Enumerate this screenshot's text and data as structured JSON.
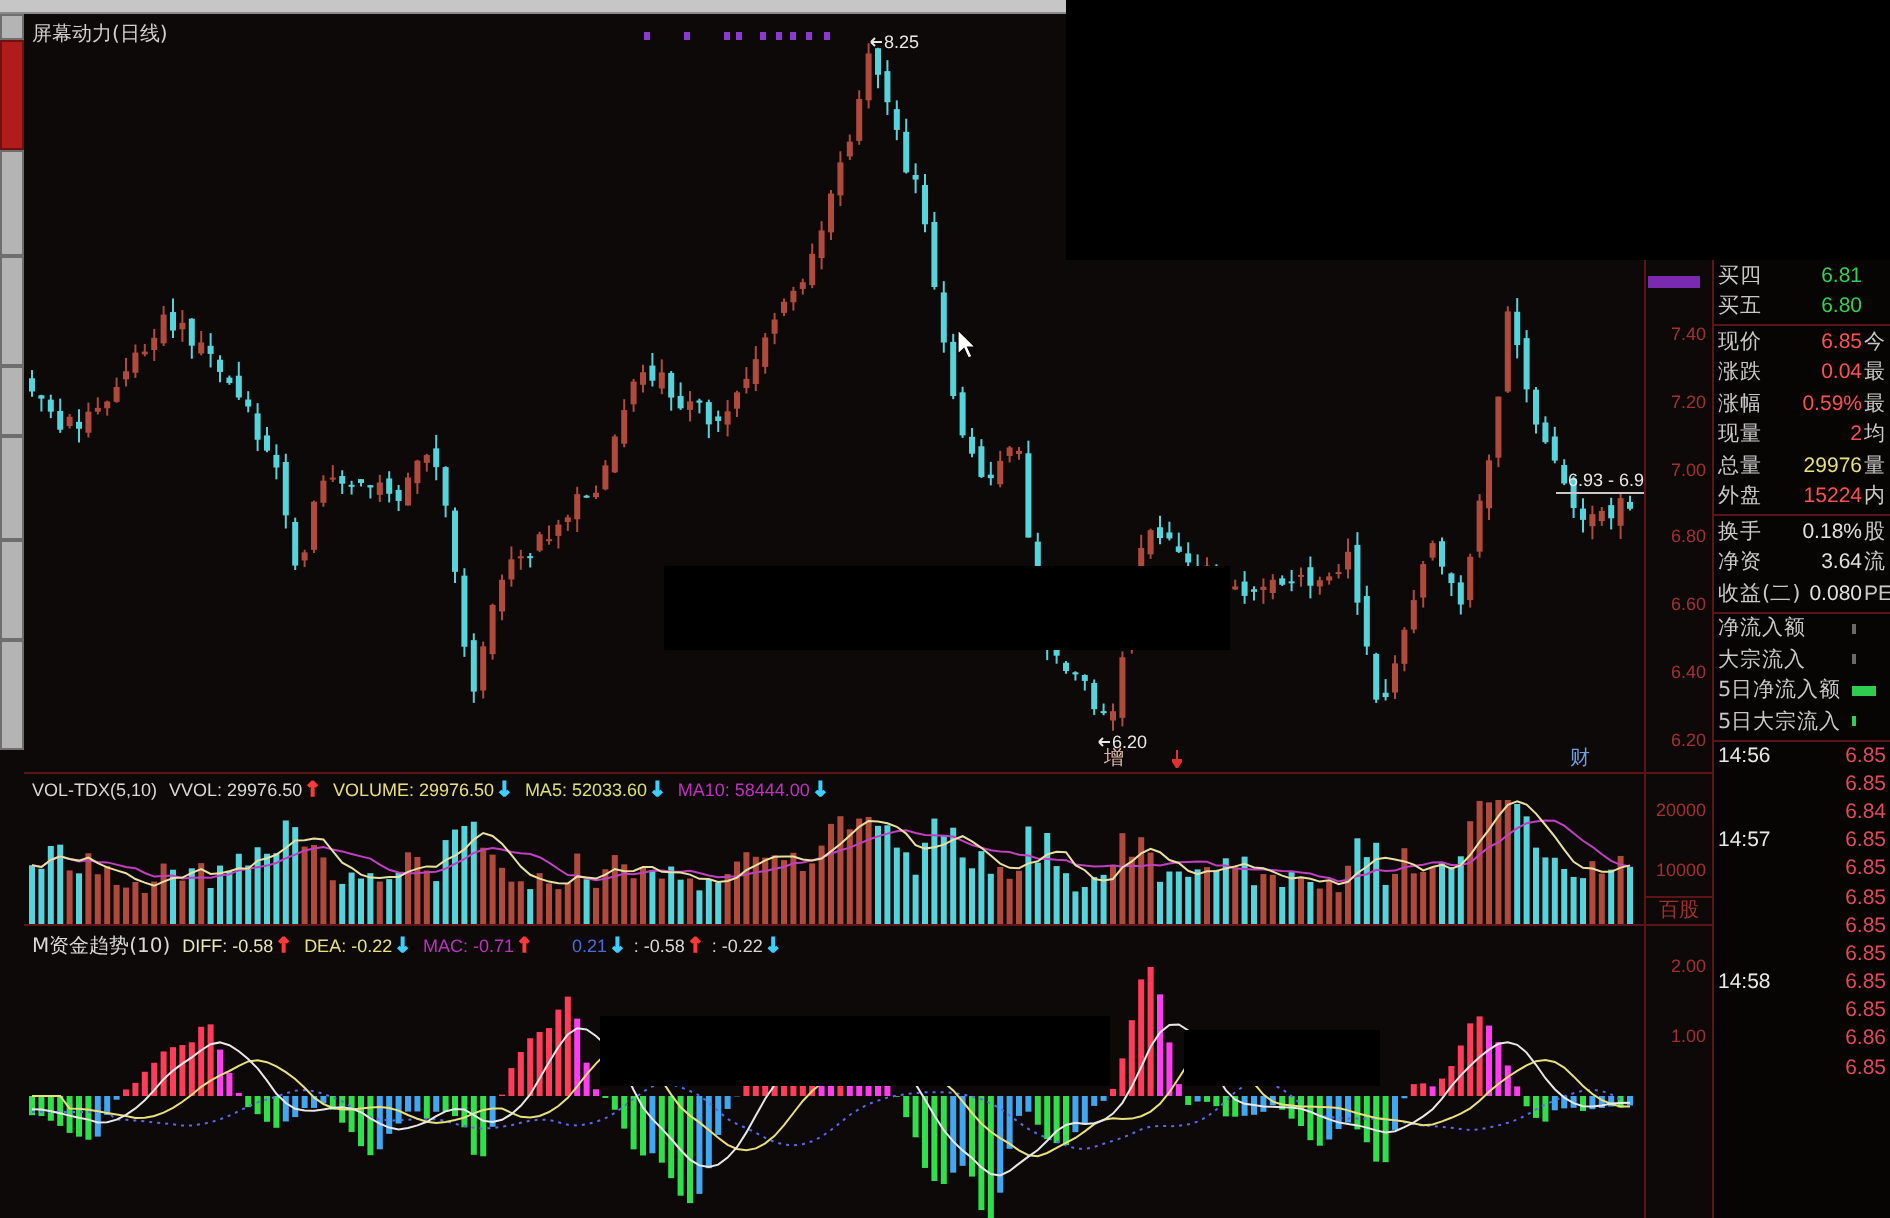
{
  "window": {
    "title": "屏幕动力(日线)"
  },
  "side_tabs": [
    {
      "selected": false
    },
    {
      "selected": true
    },
    {
      "selected": false
    },
    {
      "selected": false
    },
    {
      "selected": false
    },
    {
      "selected": false
    },
    {
      "selected": false
    },
    {
      "selected": false
    }
  ],
  "main_chart": {
    "annotations": [
      {
        "kind": "high",
        "text": "8.25"
      },
      {
        "kind": "low",
        "text": "6.20"
      },
      {
        "kind": "price_line",
        "text": "6.93 - 6.9"
      }
    ],
    "event_marks": [
      {
        "kind": "text",
        "text": "增",
        "color": "#e0b8a8"
      },
      {
        "kind": "icon",
        "color": "#e03030"
      },
      {
        "kind": "text",
        "text": "财",
        "color": "#6f9fe0"
      }
    ],
    "price_axis": [
      "7.40",
      "7.20",
      "7.00",
      "6.80",
      "6.60",
      "6.40",
      "6.20"
    ]
  },
  "volume_panel": {
    "indicator": "VOL-TDX(5,10)",
    "readings": [
      {
        "label": "VVOL: 29976.50",
        "color": "#d8d8d8",
        "arrow": {
          "text": "↑",
          "color": "#ff3a3a"
        }
      },
      {
        "label": "VOLUME: 29976.50",
        "color": "#e8e07a",
        "arrow": {
          "text": "↓",
          "color": "#3ad0ff"
        }
      },
      {
        "label": "MA5: 52033.60",
        "color": "#d8e070",
        "arrow": {
          "text": "↓",
          "color": "#3ad0ff"
        }
      },
      {
        "label": "MA10: 58444.00",
        "color": "#c030c0",
        "arrow": {
          "text": "↓",
          "color": "#3ad0ff"
        }
      }
    ],
    "axis": [
      "20000",
      "10000"
    ],
    "unit": "百股"
  },
  "macd_panel": {
    "indicator": "M资金趋势(10)",
    "readings": [
      {
        "label": "DIFF: -0.58",
        "color": "#e8e8b0",
        "arrow": {
          "text": "↑",
          "color": "#ff3a3a"
        }
      },
      {
        "label": "DEA: -0.22",
        "color": "#e8e07a",
        "arrow": {
          "text": "↓",
          "color": "#3ad0ff"
        }
      },
      {
        "label": "MAC: -0.71",
        "color": "#c030c0",
        "arrow": {
          "text": "↑",
          "color": "#ff3a3a"
        }
      }
    ],
    "secondary_readings": [
      {
        "label": "0.21",
        "color": "#4a6ae0",
        "arrow": {
          "text": "↓",
          "color": "#3ad0ff"
        }
      },
      {
        "label": ": -0.58",
        "color": "#d8d8d8",
        "arrow": {
          "text": "↑",
          "color": "#ff3a3a"
        }
      },
      {
        "label": ": -0.22",
        "color": "#d8d8d8",
        "arrow": {
          "text": "↓",
          "color": "#3ad0ff"
        }
      }
    ],
    "axis": [
      "2.00",
      "1.00"
    ]
  },
  "quote_panel": {
    "order_book": [
      {
        "label": "买四",
        "value": "6.81",
        "color": "#30d050"
      },
      {
        "label": "买五",
        "value": "6.80",
        "color": "#30d050"
      }
    ],
    "quote": [
      {
        "label": "现价",
        "value": "6.85",
        "color": "#ff5050",
        "column_3": "今"
      },
      {
        "label": "涨跌",
        "value": "0.04",
        "color": "#ff5050",
        "column_3": "最"
      },
      {
        "label": "涨幅",
        "value": "0.59%",
        "color": "#ff5050",
        "column_3": "最"
      },
      {
        "label": "现量",
        "value": "2",
        "color": "#ff5050",
        "column_3": "均"
      },
      {
        "label": "总量",
        "value": "29976",
        "color": "#e8e070",
        "column_3": "量"
      },
      {
        "label": "外盘",
        "value": "15224",
        "color": "#ff5050",
        "column_3": "内"
      }
    ],
    "stats": [
      {
        "label": "换手",
        "value": "0.18%",
        "color": "#e0e0e0",
        "column_3": "股"
      },
      {
        "label": "净资",
        "value": "3.64",
        "color": "#e0e0e0",
        "column_3": "流"
      },
      {
        "label": "收益(二)",
        "value": "0.080",
        "color": "#e0e0e0",
        "column_3": "PE"
      }
    ],
    "fund_flows": [
      {
        "label": "净流入额",
        "kind": "tick",
        "color": "#6a6a6a"
      },
      {
        "label": "大宗流入",
        "kind": "tick",
        "color": "#6a6a6a"
      },
      {
        "label": "5日净流入额",
        "kind": "bar",
        "color": "#2ecc50"
      },
      {
        "label": "5日大宗流入",
        "kind": "tick",
        "color": "#2ecc50"
      }
    ],
    "ticks": [
      {
        "time": "14:56",
        "price": "6.85"
      },
      {
        "price": "6.85"
      },
      {
        "price": "6.84"
      },
      {
        "time": "14:57",
        "price": "6.85"
      },
      {
        "price": "6.85"
      },
      {
        "price": "6.85"
      },
      {
        "price": "6.85"
      },
      {
        "price": "6.85"
      },
      {
        "time": "14:58",
        "price": "6.85"
      },
      {
        "price": "6.85"
      },
      {
        "price": "6.86"
      },
      {
        "price": "6.85"
      }
    ]
  }
}
